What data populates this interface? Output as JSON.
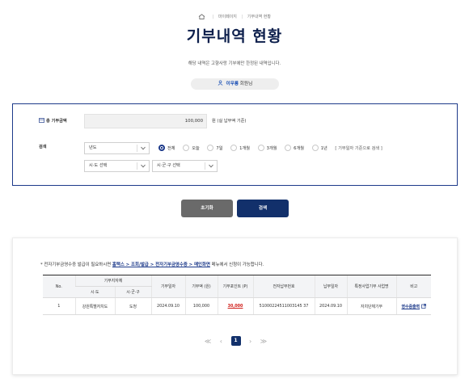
{
  "breadcrumb": {
    "items": [
      "마이페이지",
      "기부내역 현황"
    ]
  },
  "page_title": "기부내역 현황",
  "subtitle": "해당 내역은 고향사랑 기부에만 한정된 내역입니다.",
  "member": {
    "name": "이무룡",
    "suffix": "회원님"
  },
  "search": {
    "total_label": "총 기부금액",
    "total_value": "100,000",
    "total_unit": "원  (실 납부액 기준)",
    "search_label": "검색",
    "year_select": "년도",
    "sido_select": "시·도 선택",
    "sigungu_select": "시·군·구 선택",
    "periods": [
      "전체",
      "오늘",
      "7일",
      "1개월",
      "3개월",
      "6개월",
      "1년"
    ],
    "period_selected": "전체",
    "period_note": "[ 기부일자 기준으로 검색 ]"
  },
  "buttons": {
    "reset": "초기화",
    "search": "검색"
  },
  "notice": {
    "prefix": "* 전자기부금영수증 발급이 필요하시면 ",
    "path": "홈택스 > 조회/발급 > 전자기부금영수증 > 메인화면",
    "suffix": " 메뉴에서 신청이 가능합니다."
  },
  "table": {
    "headers": {
      "no": "No.",
      "region": "기부지자체",
      "sido": "시·도",
      "sigungu": "시·군·구",
      "date": "기부일자",
      "amount": "기부액 (원)",
      "point": "기부포인트 (P)",
      "pay_no": "전자납부번호",
      "pay_date": "납부일자",
      "project": "특정사업기부 사업명",
      "note": "비고"
    },
    "rows": [
      {
        "no": "1",
        "sido": "강원특별자치도",
        "sigungu": "도청",
        "date": "2024.09.10",
        "amount": "100,000",
        "point": "30,000",
        "pay_no": "51000224511003145 37",
        "pay_date": "2024.09.10",
        "project": "자치단체기부",
        "note": "영수증출력"
      }
    ]
  },
  "pager": {
    "first": "≪",
    "prev": "‹",
    "current": "1",
    "next": "›",
    "last": "≫"
  },
  "colors": {
    "navy": "#12306b",
    "accent_red": "#d0201b",
    "link_blue": "#1d3a8a"
  }
}
